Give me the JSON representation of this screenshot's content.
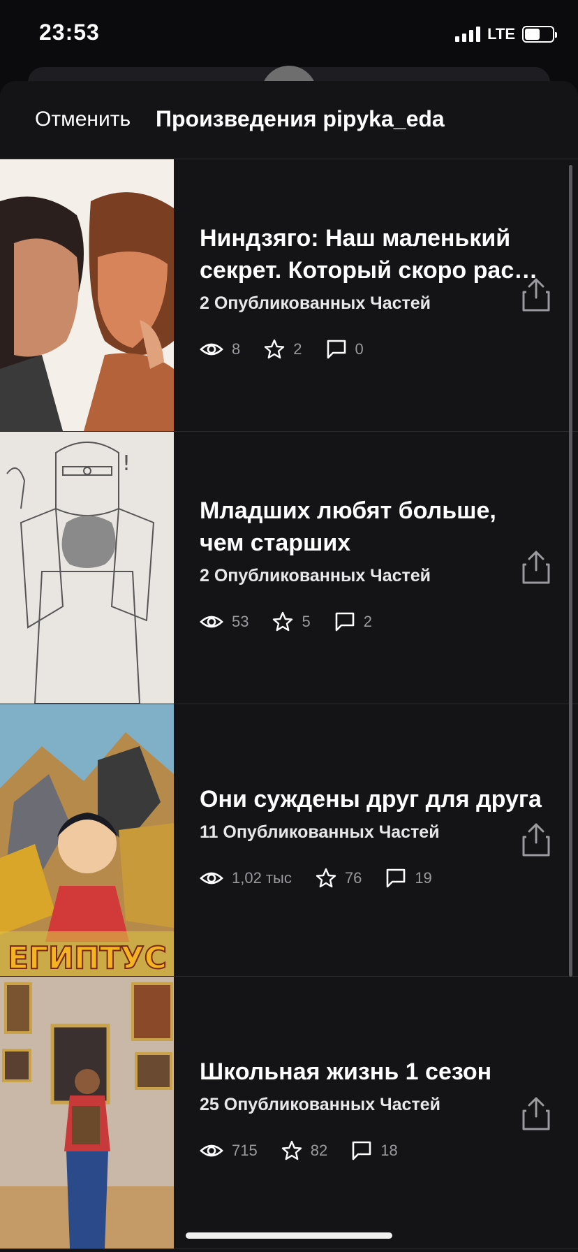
{
  "status_bar": {
    "time": "23:53",
    "network": "LTE",
    "battery_level": 0.55
  },
  "header": {
    "cancel_label": "Отменить",
    "title": "Произведения pipyka_eda"
  },
  "stories": [
    {
      "title_line1": "Ниндзяго: Наш маленький",
      "title_line2": "секрет. Который скоро рас…",
      "parts": "2 Опубликованных Частей",
      "reads": "8",
      "votes": "2",
      "comments": "0"
    },
    {
      "title_line1": "Младших любят больше,",
      "title_line2": "чем старших",
      "parts": "2 Опубликованных Частей",
      "reads": "53",
      "votes": "5",
      "comments": "2"
    },
    {
      "title_line1": "Они суждены друг для друга",
      "title_line2": "",
      "parts": "11 Опубликованных Частей",
      "reads": "1,02 тыс",
      "votes": "76",
      "comments": "19",
      "cover_caption": "ЕГИПТУС"
    },
    {
      "title_line1": "Школьная жизнь 1 сезон",
      "title_line2": "",
      "parts": "25 Опубликованных Частей",
      "reads": "715",
      "votes": "82",
      "comments": "18"
    }
  ],
  "icons": {
    "reads": "eye-icon",
    "votes": "star-icon",
    "comments": "comment-icon",
    "share": "share-icon"
  },
  "colors": {
    "background": "#141316",
    "text": "#ffffff",
    "muted": "#9a9a9f"
  }
}
